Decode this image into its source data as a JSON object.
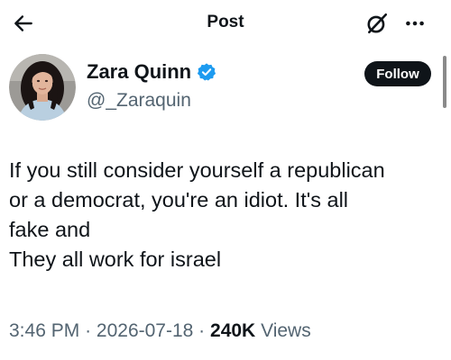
{
  "header": {
    "title": "Post",
    "back_icon": "arrow-left-icon",
    "grok_icon": "grok-icon",
    "more_icon": "more-horizontal-icon"
  },
  "author": {
    "display_name": "Zara Quinn",
    "handle": "@_Zaraquin",
    "verified": true,
    "verified_color": "#1d9bf0"
  },
  "follow_button": {
    "label": "Follow"
  },
  "tweet": {
    "lines": [
      "If you still consider yourself a republican",
      "or a democrat, you're an idiot. It's all",
      "fake and",
      "They all work for israel"
    ]
  },
  "meta": {
    "time": "3:46 PM",
    "separator": "·",
    "date": "2026-07-18",
    "views_count": "240K",
    "views_label": "Views"
  },
  "colors": {
    "text_primary": "#0f1419",
    "text_secondary": "#536471",
    "follow_bg": "#0f1419",
    "follow_text": "#ffffff"
  }
}
